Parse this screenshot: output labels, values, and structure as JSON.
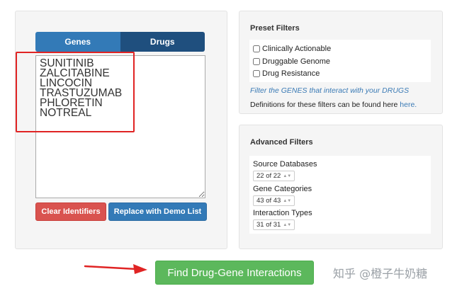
{
  "tabs": {
    "genes": "Genes",
    "drugs": "Drugs"
  },
  "identifiers": {
    "value": "SUNITINIB\nZALCITABINE\nLINCOCIN\nTRASTUZUMAB\nPHLORETIN\nNOTREAL"
  },
  "buttons": {
    "clear": "Clear Identifiers",
    "demo": "Replace with Demo List",
    "find": "Find Drug-Gene Interactions"
  },
  "preset_filters": {
    "title": "Preset Filters",
    "options": [
      "Clinically Actionable",
      "Druggable Genome",
      "Drug Resistance"
    ],
    "hint": "Filter the GENES that interact with your DRUGS",
    "definitions_text": "Definitions for these filters can be found here ",
    "definitions_link": "here."
  },
  "advanced_filters": {
    "title": "Advanced Filters",
    "source_label": "Source Databases",
    "source_value": "22 of 22",
    "category_label": "Gene Categories",
    "category_value": "43 of 43",
    "interaction_label": "Interaction Types",
    "interaction_value": "31 of 31"
  },
  "watermark": "知乎 @橙子牛奶糖",
  "colors": {
    "primary": "#337ab7",
    "danger": "#d9534f",
    "success": "#5cb85c",
    "annotation_red": "#e02424"
  }
}
